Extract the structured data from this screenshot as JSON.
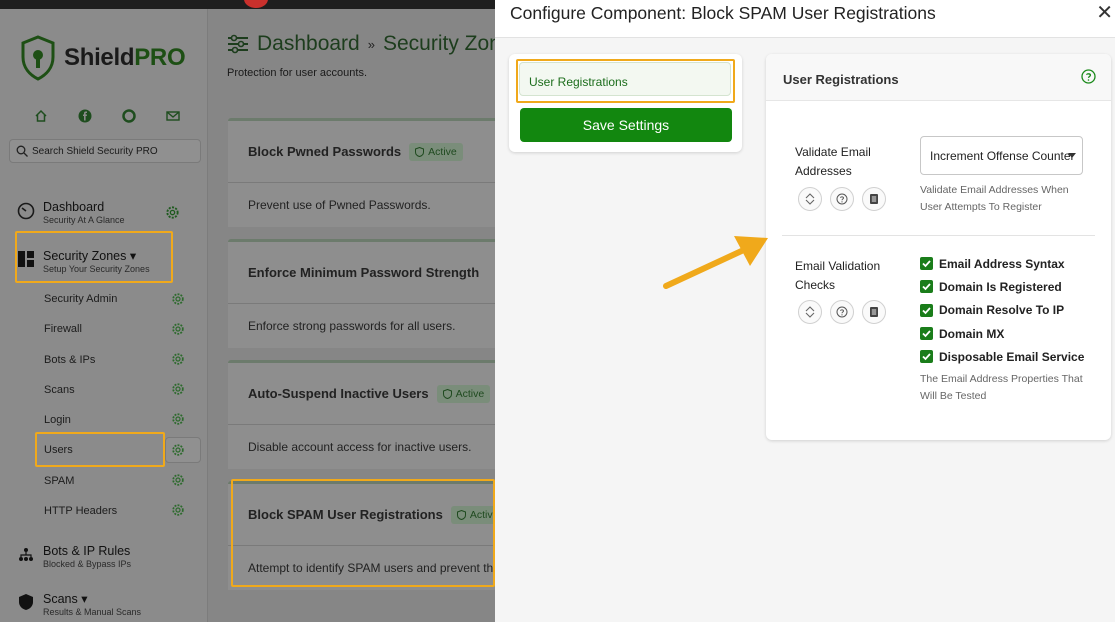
{
  "app": {
    "brand_part1": "Shield",
    "brand_part2": "PRO",
    "search_placeholder": "Search Shield Security PRO",
    "nav_groups": [
      {
        "title": "Dashboard",
        "subtitle": "Security At A Glance"
      },
      {
        "title": "Security Zones ▾",
        "subtitle": "Setup Your Security Zones"
      },
      {
        "title": "Bots & IP Rules",
        "subtitle": "Blocked & Bypass IPs"
      },
      {
        "title": "Scans ▾",
        "subtitle": "Results & Manual Scans"
      }
    ],
    "zone_items": [
      "Security Admin",
      "Firewall",
      "Bots & IPs",
      "Scans",
      "Login",
      "Users",
      "SPAM",
      "HTTP Headers"
    ],
    "breadcrumb": {
      "root": "Dashboard",
      "separator": "»",
      "current": "Security Zones"
    },
    "page_subtitle": "Protection for user accounts.",
    "cards": [
      {
        "title": "Block Pwned Passwords",
        "badge": "Active",
        "description": "Prevent use of Pwned Passwords."
      },
      {
        "title": "Enforce Minimum Password Strength",
        "badge": "",
        "description": "Enforce strong passwords for all users."
      },
      {
        "title": "Auto-Suspend Inactive Users",
        "badge": "Active",
        "description": "Disable account access for inactive users."
      },
      {
        "title": "Block SPAM User Registrations",
        "badge": "Active",
        "description": "Attempt to identify SPAM users and prevent them from registering."
      }
    ]
  },
  "modal": {
    "title": "Configure Component: Block SPAM User Registrations",
    "close_icon": "close-icon",
    "tab_label": "User Registrations",
    "save_label": "Save Settings",
    "section_title": "User Registrations",
    "options": [
      {
        "label": "Validate Email Addresses",
        "select_value": "Increment Offense Counter",
        "help": "Validate Email Addresses When User Attempts To Register"
      },
      {
        "label": "Email Validation Checks",
        "checks": [
          {
            "label": "Email Address Syntax",
            "checked": true
          },
          {
            "label": "Domain Is Registered",
            "checked": true
          },
          {
            "label": "Domain Resolve To IP",
            "checked": true
          },
          {
            "label": "Domain MX",
            "checked": true
          },
          {
            "label": "Disposable Email Service",
            "checked": true
          }
        ],
        "help": "The Email Address Properties That Will Be Tested"
      }
    ]
  },
  "colors": {
    "accent": "#12870f",
    "highlight": "#f0a91b",
    "overlay": "#8b8b8b"
  }
}
